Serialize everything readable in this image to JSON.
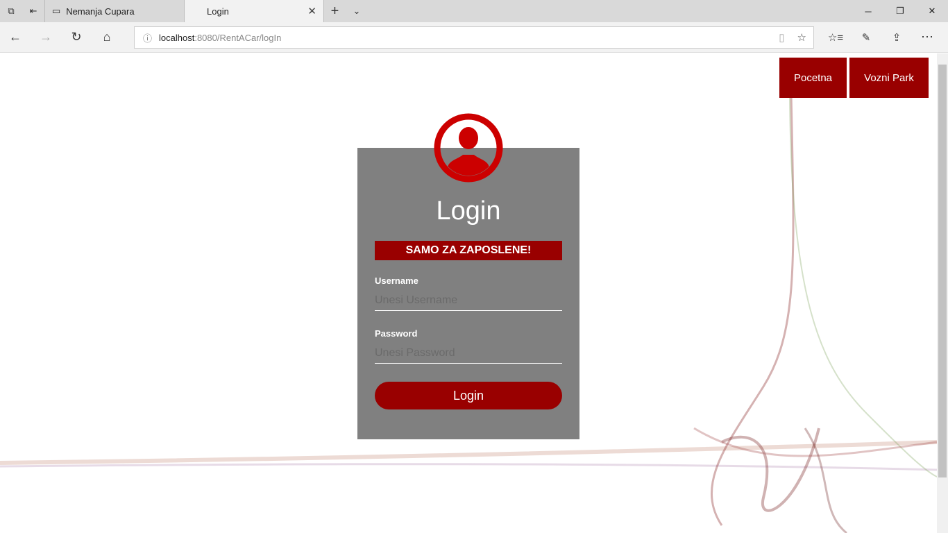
{
  "browser": {
    "tabs": [
      {
        "title": "Nemanja Cupara"
      },
      {
        "title": "Login",
        "active": true
      }
    ],
    "url": {
      "host": "localhost",
      "path": ":8080/RentACar/logIn"
    }
  },
  "nav": {
    "items": [
      "Pocetna",
      "Vozni Park"
    ]
  },
  "login": {
    "title": "Login",
    "notice": "SAMO ZA ZAPOSLENE!",
    "username_label": "Username",
    "username_placeholder": "Unesi Username",
    "password_label": "Password",
    "password_placeholder": "Unesi Password",
    "button": "Login"
  },
  "colors": {
    "accent": "#990000",
    "avatar": "#cc0000",
    "card": "#808080"
  }
}
